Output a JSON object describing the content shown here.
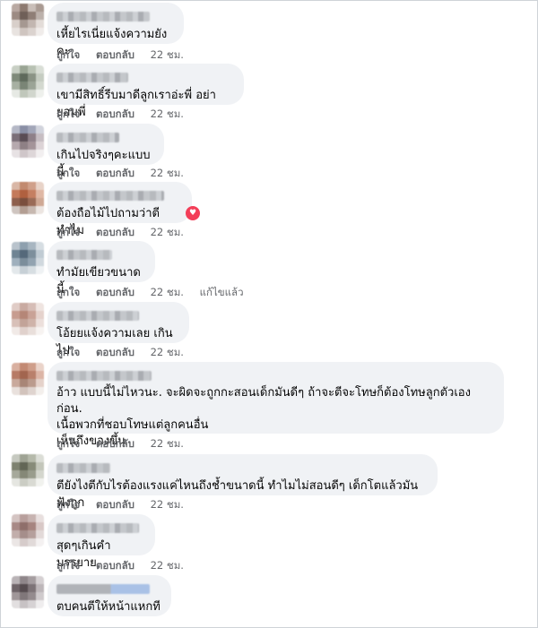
{
  "comments": [
    {
      "text": "เหี้ยไรเนี่ยแจ้งความยังคะ",
      "like": "ถูกใจ",
      "reply": "ตอบกลับ",
      "time": "22 ชม.",
      "edited": "",
      "reaction": ""
    },
    {
      "text": "เขามีสิทธิ์รีบมาดีลูกเราอ่ะพี่ อย่ายอมพี่",
      "like": "ถูกใจ",
      "reply": "ตอบกลับ",
      "time": "22 ชม.",
      "edited": "",
      "reaction": ""
    },
    {
      "text": "เกินไปจริงๆคะแบบนี้",
      "like": "ถูกใจ",
      "reply": "ตอบกลับ",
      "time": "22 ชม.",
      "edited": "",
      "reaction": ""
    },
    {
      "text": "ต้องถือไม้ไปถามว่าตีทำไม",
      "like": "ถูกใจ",
      "reply": "ตอบกลับ",
      "time": "22 ชม.",
      "edited": "",
      "reaction": "heart-reaction"
    },
    {
      "text": "ทำมัยเขียวขนาดนี้",
      "like": "ถูกใจ",
      "reply": "ตอบกลับ",
      "time": "22 ชม.",
      "edited": "แก้ไขแล้ว",
      "reaction": ""
    },
    {
      "text": "โอ้ยยแจ้งความเลย เกินไป",
      "like": "ถูกใจ",
      "reply": "ตอบกลับ",
      "time": "22 ชม.",
      "edited": "",
      "reaction": ""
    },
    {
      "text": "อ้าว แบบนี้ไม่ไหวนะ. จะผิดจะถูกกะสอนเด็กมันดีๆ ถ้าจะตีจะโทษก็ต้องโทษลูกตัวเองก่อน.\nเนื้อพวกที่ชอบโทษแต่ลูกคนอื่น\nเห็นถึงของขึ้น",
      "like": "ถูกใจ",
      "reply": "ตอบกลับ",
      "time": "22 ชม.",
      "edited": "",
      "reaction": ""
    },
    {
      "text": "ตียังไงตีกับไรต้องแรงแค่ไหนถึงช้ำขนาดนี้ ทำไมไม่สอนดีๆ เด็กโตแล้วมันฟังถูก",
      "like": "ถูกใจ",
      "reply": "ตอบกลับ",
      "time": "22 ชม.",
      "edited": "",
      "reaction": ""
    },
    {
      "text": "สุดๆเกินคำบรรยาย",
      "like": "ถูกใจ",
      "reply": "ตอบกลับ",
      "time": "22 ชม.",
      "edited": "",
      "reaction": ""
    },
    {
      "text": "ตบคนตีให้หน้าแหกที",
      "like": "",
      "reply": "",
      "time": "",
      "edited": "",
      "reaction": ""
    }
  ],
  "colors": {
    "bubble": "#f0f2f5",
    "meta_text": "#65676b",
    "comment_text": "#050505",
    "heart": "#f33e58"
  }
}
